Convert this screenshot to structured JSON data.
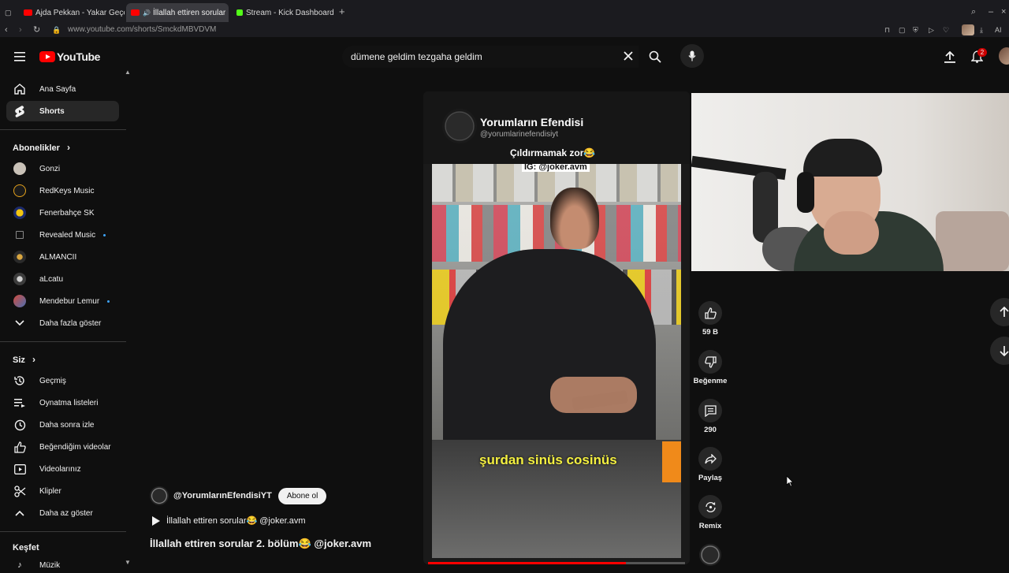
{
  "browser": {
    "tabs": [
      {
        "label": "Ajda Pekkan - Yakar Geçe",
        "color": "#ff0000"
      },
      {
        "label": "İllallah ettiren sorular",
        "color": "#ff0000"
      },
      {
        "label": "Stream - Kick Dashboard",
        "color": "#53fc18"
      }
    ],
    "new_tab": "+",
    "url": "www.youtube.com/shorts/SmckdMBVDVM",
    "extension_label": "AI"
  },
  "header": {
    "logo_text": "YouTube",
    "search_value": "dümene geldim tezgaha geldim",
    "notification_count": "2"
  },
  "sidebar": {
    "main": [
      {
        "label": "Ana Sayfa",
        "icon": "home-icon"
      },
      {
        "label": "Shorts",
        "icon": "shorts-icon"
      }
    ],
    "subscriptions_title": "Abonelikler",
    "subscriptions": [
      {
        "label": "Gonzi",
        "color": "#c9c2b8",
        "dot": false
      },
      {
        "label": "RedKeys Music",
        "color": "#1a1a1a",
        "dot": false
      },
      {
        "label": "Fenerbahçe SK",
        "color": "#f2c511",
        "dot": false
      },
      {
        "label": "Revealed Music",
        "color": "#111111",
        "dot": true
      },
      {
        "label": "ALMANCII",
        "color": "#2a2a2a",
        "dot": false
      },
      {
        "label": "aLcatu",
        "color": "#3c3c3c",
        "dot": false
      },
      {
        "label": "Mendebur Lemur",
        "color": "#d14b3c",
        "dot": true
      }
    ],
    "show_more": "Daha fazla göster",
    "you_title": "Siz",
    "you_items": [
      {
        "label": "Geçmiş",
        "icon": "history-icon"
      },
      {
        "label": "Oynatma listeleri",
        "icon": "playlists-icon"
      },
      {
        "label": "Daha sonra izle",
        "icon": "watch-later-icon"
      },
      {
        "label": "Beğendiğim videolar",
        "icon": "liked-icon"
      },
      {
        "label": "Videolarınız",
        "icon": "your-videos-icon"
      },
      {
        "label": "Klipler",
        "icon": "clips-icon"
      },
      {
        "label": "Daha az göster",
        "icon": "chevron-up-icon"
      }
    ],
    "explore_title": "Keşfet",
    "explore_first": "Müzik"
  },
  "short": {
    "overlay_channel": "Yorumların Efendisi",
    "overlay_handle": "@yorumlarinefendisiyt",
    "overlay_subtitle": "Çıldırmamak zor😂",
    "overlay_ig": "IG: @joker.avm",
    "burned_caption": "şurdan sinüs cosinüs",
    "channel_handle": "@YorumlarınEfendisiYT",
    "subscribe_label": "Abone ol",
    "audio_title": "İllallah ettiren sorular😂 @joker.avm",
    "title": "İllallah ettiren sorular 2. bölüm😂 @joker.avm",
    "progress": 0.77
  },
  "actions": {
    "like_count": "59 B",
    "dislike_label": "Beğenme",
    "comments_count": "290",
    "share_label": "Paylaş",
    "remix_label": "Remix"
  },
  "colors": {
    "background": "#0f0f0f",
    "accent_red": "#ff0000",
    "kick_green": "#53fc18",
    "subscribe_bg": "#f1f1f1"
  }
}
